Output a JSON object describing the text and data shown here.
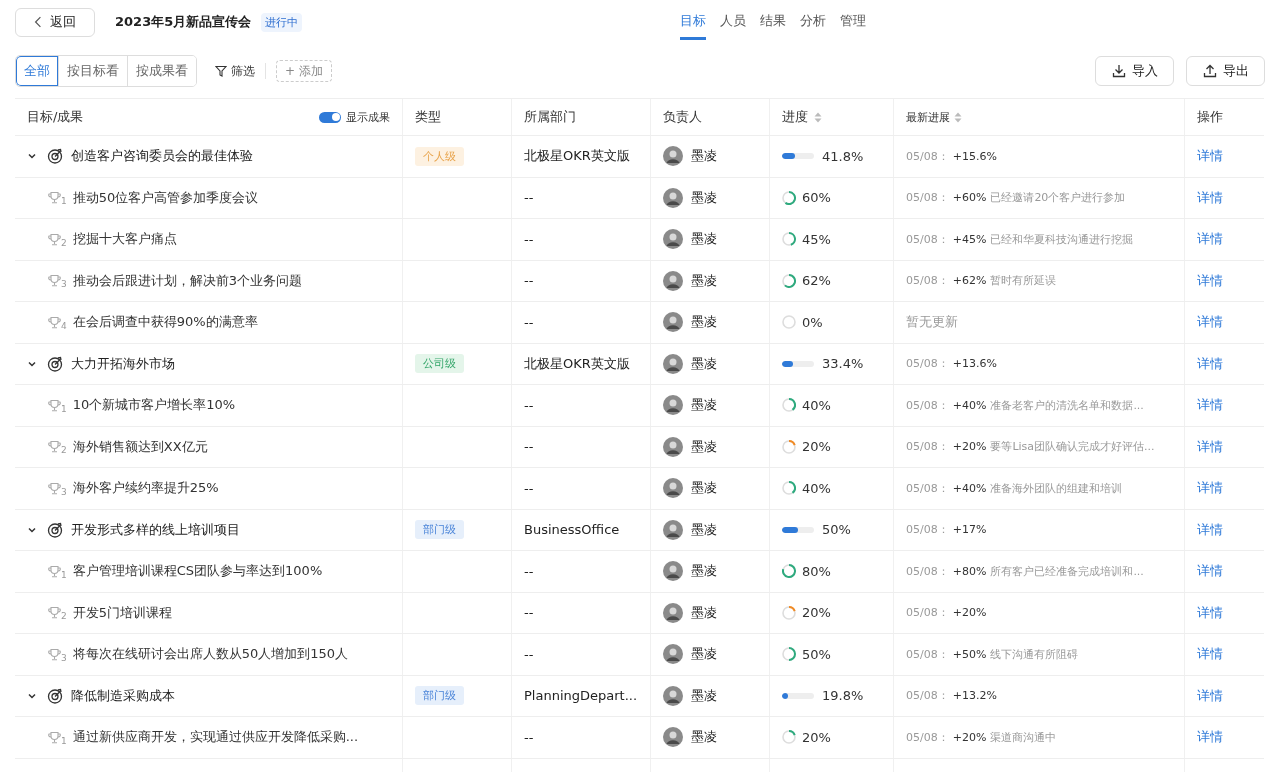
{
  "header": {
    "back": "返回",
    "title": "2023年5月新品宣传会",
    "status": "进行中"
  },
  "tabs": [
    {
      "label": "目标",
      "selected": true
    },
    {
      "label": "人员",
      "selected": false
    },
    {
      "label": "结果",
      "selected": false
    },
    {
      "label": "分析",
      "selected": false
    },
    {
      "label": "管理",
      "selected": false
    }
  ],
  "view_modes": [
    {
      "label": "全部",
      "selected": true
    },
    {
      "label": "按目标看",
      "selected": false
    },
    {
      "label": "按成果看",
      "selected": false
    }
  ],
  "filter": "筛选",
  "add": "+ 添加",
  "import": "导入",
  "export": "导出",
  "table": {
    "columns": [
      {
        "label": "目标/成果",
        "sortable": false
      },
      {
        "label": "类型",
        "sortable": false
      },
      {
        "label": "所属部门",
        "sortable": false
      },
      {
        "label": "负责人",
        "sortable": false
      },
      {
        "label": "进度",
        "sortable": true
      },
      {
        "label": "最新进展",
        "sortable": true
      },
      {
        "label": "操作",
        "sortable": false
      }
    ],
    "show_results": {
      "label": "显示成果",
      "on": true
    },
    "rows": [
      {
        "title": "创造客户咨询委员会的最佳体验",
        "expanded": true,
        "tag": {
          "label": "个人级",
          "kind": "personal"
        },
        "department": "北极星OKR英文版",
        "owner": "墨凌",
        "progress": {
          "level": 0.418,
          "text": "41.8%"
        },
        "latest": {
          "date": "05/08：",
          "delta": "+15.6%"
        },
        "action": "详情",
        "children": [
          {
            "index": "1",
            "title": "推动50位客户高管参加季度会议",
            "department": "--",
            "owner": "墨凌",
            "progress": {
              "text": "60%",
              "color": "#2eaa7e"
            },
            "latest": {
              "date": "05/08：",
              "delta": "+60%",
              "note": "已经邀请20个客户进行参加"
            },
            "action": "详情"
          },
          {
            "index": "2",
            "title": "挖掘十大客户痛点",
            "department": "--",
            "owner": "墨凌",
            "progress": {
              "text": "45%",
              "color": "#2eaa7e"
            },
            "latest": {
              "date": "05/08：",
              "delta": "+45%",
              "note": "已经和华夏科技沟通进行挖掘"
            },
            "action": "详情"
          },
          {
            "index": "3",
            "title": "推动会后跟进计划，解决前3个业务问题",
            "department": "--",
            "owner": "墨凌",
            "progress": {
              "text": "62%",
              "color": "#2eaa7e"
            },
            "latest": {
              "date": "05/08：",
              "delta": "+62%",
              "note": "暂时有所延误"
            },
            "action": "详情"
          },
          {
            "index": "4",
            "title": "在会后调查中获得90%的满意率",
            "department": "--",
            "owner": "墨凌",
            "progress": {
              "text": "0%"
            },
            "latest": {
              "empty": "暂无更新"
            },
            "action": "详情"
          }
        ]
      },
      {
        "title": "大力开拓海外市场",
        "expanded": true,
        "tag": {
          "label": "公司级",
          "kind": "company"
        },
        "department": "北极星OKR英文版",
        "owner": "墨凌",
        "progress": {
          "level": 0.334,
          "text": "33.4%"
        },
        "latest": {
          "date": "05/08：",
          "delta": "+13.6%"
        },
        "action": "详情",
        "children": [
          {
            "index": "1",
            "title": "10个新城市客户增长率10%",
            "department": "--",
            "owner": "墨凌",
            "progress": {
              "text": "40%",
              "color": "#2eaa7e"
            },
            "latest": {
              "date": "05/08：",
              "delta": "+40%",
              "note": "准备老客户的清洗名单和数据..."
            },
            "action": "详情"
          },
          {
            "index": "2",
            "title": "海外销售额达到XX亿元",
            "department": "--",
            "owner": "墨凌",
            "progress": {
              "text": "20%",
              "color": "#f08a24"
            },
            "latest": {
              "date": "05/08：",
              "delta": "+20%",
              "note": "要等Lisa团队确认完成才好评估..."
            },
            "action": "详情"
          },
          {
            "index": "3",
            "title": "海外客户续约率提升25%",
            "department": "--",
            "owner": "墨凌",
            "progress": {
              "text": "40%",
              "color": "#2eaa7e"
            },
            "latest": {
              "date": "05/08：",
              "delta": "+40%",
              "note": "准备海外团队的组建和培训"
            },
            "action": "详情"
          }
        ]
      },
      {
        "title": "开发形式多样的线上培训项目",
        "expanded": true,
        "tag": {
          "label": "部门级",
          "kind": "department"
        },
        "department": "BusinessOffice",
        "owner": "墨凌",
        "progress": {
          "level": 0.5,
          "text": "50%"
        },
        "latest": {
          "date": "05/08：",
          "delta": "+17%"
        },
        "action": "详情",
        "children": [
          {
            "index": "1",
            "title": "客户管理培训课程CS团队参与率达到100%",
            "department": "--",
            "owner": "墨凌",
            "progress": {
              "text": "80%",
              "color": "#2eaa7e"
            },
            "latest": {
              "date": "05/08：",
              "delta": "+80%",
              "note": "所有客户已经准备完成培训和..."
            },
            "action": "详情"
          },
          {
            "index": "2",
            "title": "开发5门培训课程",
            "department": "--",
            "owner": "墨凌",
            "progress": {
              "text": "20%",
              "color": "#f08a24"
            },
            "latest": {
              "date": "05/08：",
              "delta": "+20%"
            },
            "action": "详情"
          },
          {
            "index": "3",
            "title": "将每次在线研讨会出席人数从50人增加到150人",
            "department": "--",
            "owner": "墨凌",
            "progress": {
              "text": "50%",
              "color": "#2eaa7e"
            },
            "latest": {
              "date": "05/08：",
              "delta": "+50%",
              "note": "线下沟通有所阻碍"
            },
            "action": "详情"
          }
        ]
      },
      {
        "title": "降低制造采购成本",
        "expanded": true,
        "tag": {
          "label": "部门级",
          "kind": "department"
        },
        "department": "PlanningDepart...",
        "owner": "墨凌",
        "progress": {
          "level": 0.198,
          "text": "19.8%"
        },
        "latest": {
          "date": "05/08：",
          "delta": "+13.2%"
        },
        "action": "详情",
        "children": [
          {
            "index": "1",
            "title": "通过新供应商开发，实现通过供应开发降低采购...",
            "department": "--",
            "owner": "墨凌",
            "progress": {
              "text": "20%",
              "color": "#2eaa7e"
            },
            "latest": {
              "date": "05/08：",
              "delta": "+20%",
              "note": "渠道商沟通中"
            },
            "action": "详情"
          }
        ]
      }
    ]
  }
}
